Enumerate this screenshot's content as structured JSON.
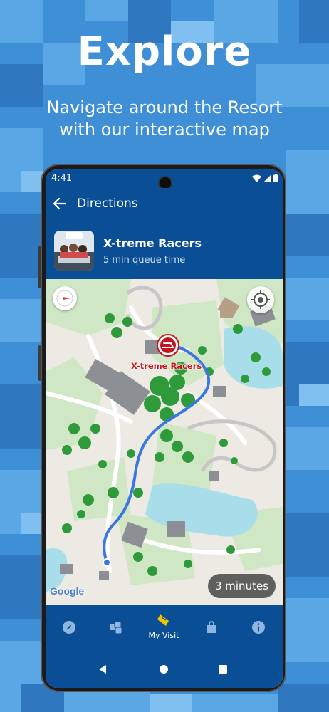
{
  "promo": {
    "headline": "Explore",
    "subline": "Navigate around the Resort with our interactive map"
  },
  "status_bar": {
    "time": "4:41"
  },
  "app_bar": {
    "title": "Directions",
    "back_icon": "arrow-back-icon"
  },
  "attraction": {
    "name": "X-treme Racers",
    "queue_text": "5 min queue time"
  },
  "map": {
    "pin_label": "X-treme Racers",
    "duration_label": "3 minutes",
    "attribution": "Google",
    "colors": {
      "route": "#3a78e0",
      "pin": "#c4141c",
      "trees": "#2f9a3a"
    }
  },
  "bottom_nav": {
    "items": [
      {
        "label": "",
        "icon": "compass-icon"
      },
      {
        "label": "",
        "icon": "dice-icon"
      },
      {
        "label": "My Visit",
        "icon": "ticket-icon",
        "active": true
      },
      {
        "label": "",
        "icon": "shopping-bag-icon"
      },
      {
        "label": "",
        "icon": "info-icon"
      }
    ]
  },
  "colors": {
    "brand": "#0a4f95",
    "background": "#3f8fd6",
    "accent_yellow": "#f3c300"
  }
}
